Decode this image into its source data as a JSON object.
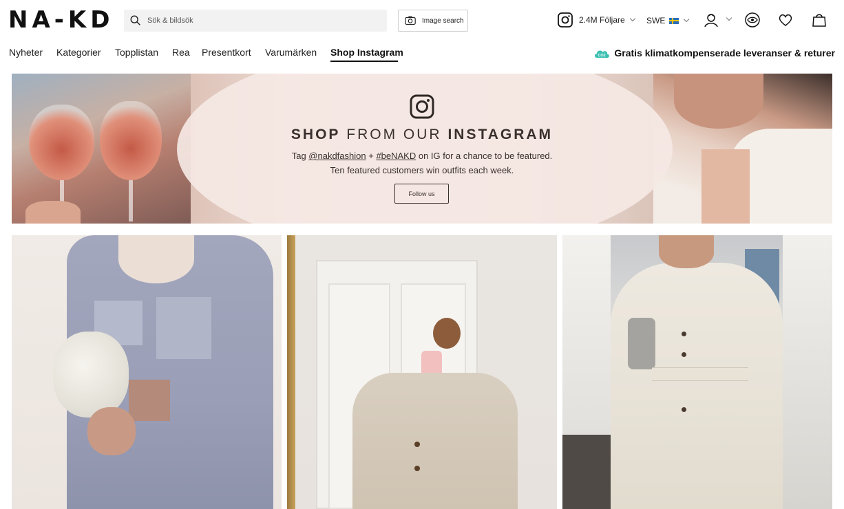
{
  "header": {
    "logo": "NA-KD",
    "search_placeholder": "Sök & bildsök",
    "image_search_label": "Image search",
    "followers": "2.4M Följare",
    "country": "SWE"
  },
  "icons": {
    "search": "search-icon",
    "camera": "camera-icon",
    "instagram": "instagram-icon",
    "account": "account-icon",
    "recently_viewed": "eye-icon",
    "wishlist": "heart-icon",
    "cart": "shopping-bag-icon",
    "climate": "co2-cloud-icon"
  },
  "nav": {
    "items": [
      "Nyheter",
      "Kategorier",
      "Topplistan",
      "Rea",
      "Presentkort",
      "Varumärken",
      "Shop Instagram"
    ],
    "active": "Shop Instagram",
    "promo": "Gratis klimatkompenserade leveranser & returer",
    "promo_badge": "CO2"
  },
  "hero": {
    "title_bold_1": "SHOP",
    "title_mid": "FROM OUR",
    "title_bold_2": "INSTAGRAM",
    "line1_prefix": "Tag ",
    "line1_handle": "@nakdfashion",
    "line1_plus": " + ",
    "line1_hashtag": "#beNAKD",
    "line1_suffix": " on IG for a chance to be featured.",
    "line2": "Ten featured customers win outfits each week.",
    "button": "Follow us"
  },
  "colors": {
    "brand_text": "#111111",
    "accent_cloud": "#3bbfb0",
    "hero_text": "#3a302d"
  }
}
